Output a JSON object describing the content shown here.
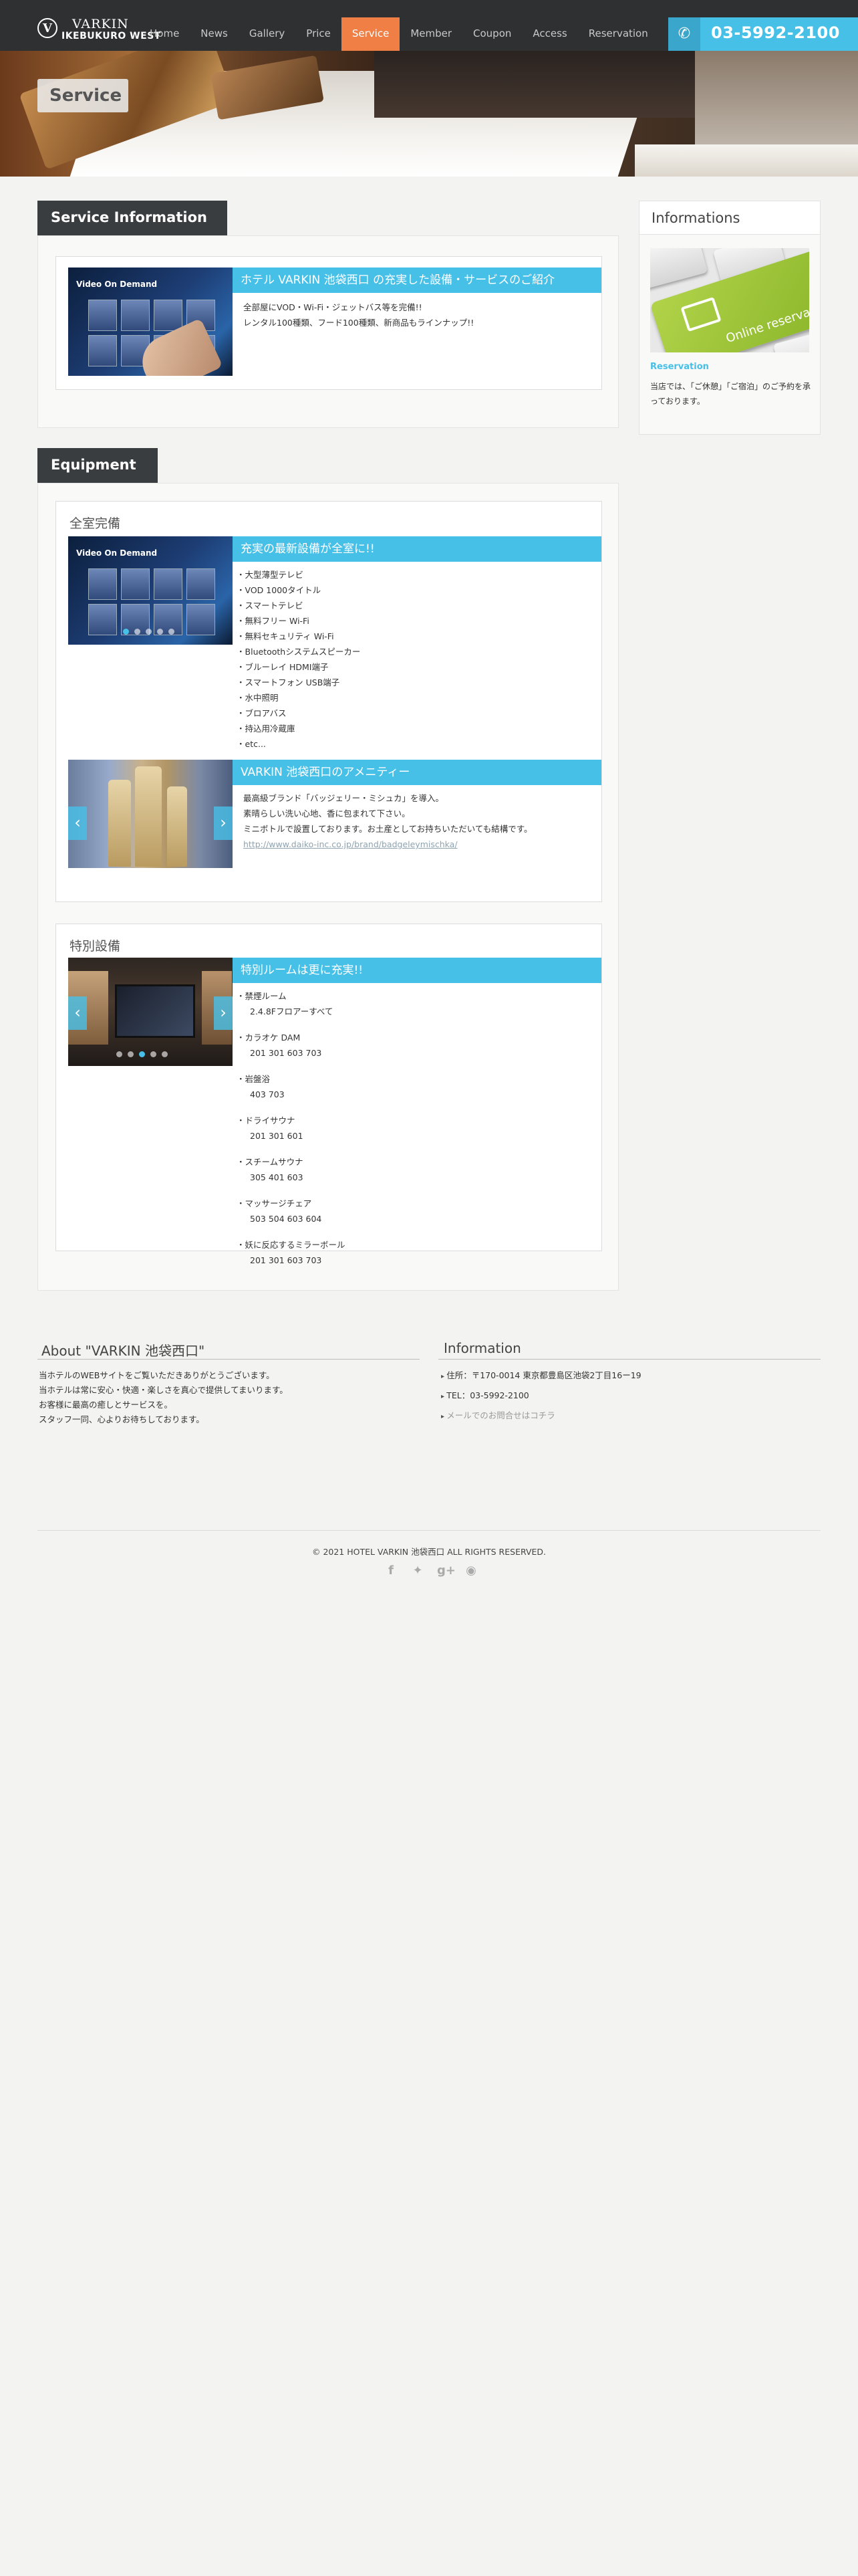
{
  "header": {
    "logo_line1": "VARKIN",
    "logo_line2": "IKEBUKURO WEST",
    "nav": [
      "Home",
      "News",
      "Gallery",
      "Price",
      "Service",
      "Member",
      "Coupon",
      "Access",
      "Reservation"
    ],
    "active_nav": "Service",
    "phone": "03-5992-2100"
  },
  "banner": {
    "title": "Service"
  },
  "service_info": {
    "heading": "Service Information",
    "bar": "ホテル VARKIN 池袋西口 の充実した設備・サービスのご紹介",
    "lines": [
      "全部屋にVOD・Wi-Fi・ジェットバス等を完備!!",
      "レンタル100種類、フード100種類、新商品もラインナップ!!"
    ],
    "image_caption": "Video On Demand"
  },
  "equipment": {
    "heading": "Equipment",
    "card1": {
      "title": "全室完備",
      "bar1": "充実の最新設備が全室に!!",
      "image_caption": "Video On Demand",
      "items": [
        "大型薄型テレビ",
        "VOD 1000タイトル",
        "スマートテレビ",
        "無料フリー Wi-Fi",
        "無料セキュリティ Wi-Fi",
        "Bluetoothシステムスピーカー",
        "ブルーレイ HDMI端子",
        "スマートフォン USB端子",
        "水中照明",
        "ブロアバス",
        "持込用冷蔵庫",
        "etc..."
      ],
      "bar2": "VARKIN 池袋西口のアメニティー",
      "amenity_lines": [
        "最高級ブランド「バッジェリー・ミシュカ」を導入。",
        "素晴らしい洗い心地、香に包まれて下さい。",
        "ミニボトルで設置しております。お土産としてお持ちいただいても結構です。"
      ],
      "amenity_link": "http://www.daiko-inc.co.jp/brand/badgeleymischka/"
    },
    "card2": {
      "title": "特別設備",
      "bar": "特別ルームは更に充実!!",
      "items": [
        {
          "name": "禁煙ルーム",
          "rooms": "2.4.8Fフロアーすべて"
        },
        {
          "name": "カラオケ DAM",
          "rooms": "201 301 603 703"
        },
        {
          "name": "岩盤浴",
          "rooms": "403 703"
        },
        {
          "name": "ドライサウナ",
          "rooms": "201 301 601"
        },
        {
          "name": "スチームサウナ",
          "rooms": "305 401 603"
        },
        {
          "name": "マッサージチェア",
          "rooms": "503 504 603 604"
        },
        {
          "name": "妖に反応するミラーボール",
          "rooms": "201 301 603 703"
        }
      ]
    }
  },
  "sidebar": {
    "heading": "Informations",
    "image_text": "Online reservation",
    "reservation_title": "Reservation",
    "reservation_text": "当店では、「ご休憩」「ご宿泊」のご予約を承っております。"
  },
  "footer": {
    "about_title": "About \"VARKIN 池袋西口\"",
    "about_lines": [
      "当ホテルのWEBサイトをご覧いただきありがとうございます。",
      "当ホテルは常に安心・快適・楽しさを真心で提供してまいります。",
      "お客様に最高の癒しとサービスを。",
      "スタッフ一同、心よりお待ちしております。"
    ],
    "info_title": "Information",
    "info_items": [
      "住所：〒170-0014 東京都豊島区池袋2丁目16ー19",
      "TEL：03-5992-2100",
      "メールでのお問合せはコチラ"
    ],
    "copyright": "© 2021 HOTEL VARKIN 池袋西口 ALL RIGHTS RESERVED.",
    "social_icons": [
      "facebook-icon",
      "twitter-icon",
      "googleplus-icon",
      "rss-icon"
    ]
  },
  "colors": {
    "accent_blue": "#47c0e8",
    "active_orange": "#ef7f45",
    "header_dark": "#2e3032"
  }
}
